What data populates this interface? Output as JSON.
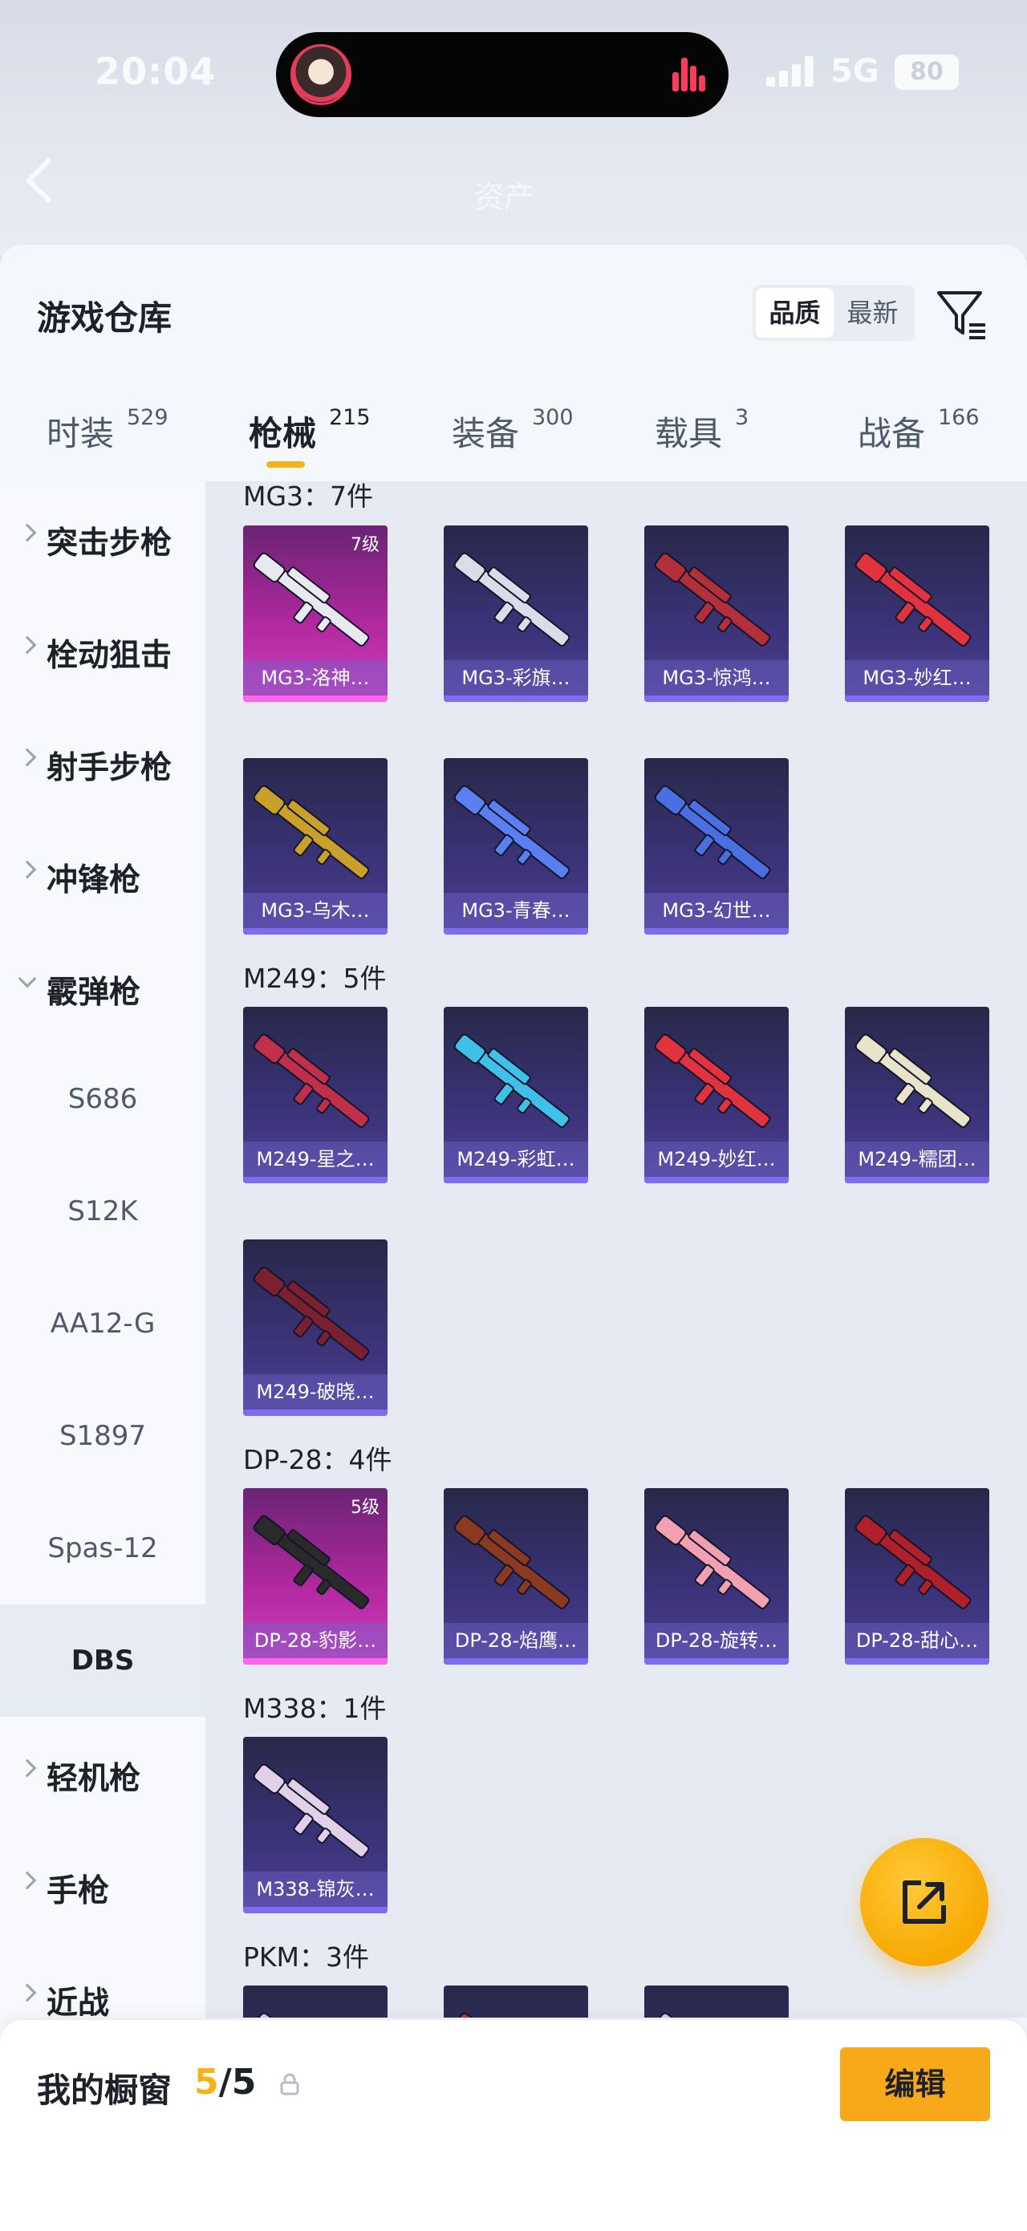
{
  "status_bar": {
    "time": "20:04",
    "network": "5G",
    "battery": "80"
  },
  "background_tabs": [
    "",
    "资产",
    ""
  ],
  "header": {
    "title": "游戏仓库",
    "sort_options": [
      "品质",
      "最新"
    ],
    "sort_selected": "品质"
  },
  "category_tabs": [
    {
      "label": "时装",
      "count": "529",
      "active": false
    },
    {
      "label": "枪械",
      "count": "215",
      "active": true
    },
    {
      "label": "装备",
      "count": "300",
      "active": false
    },
    {
      "label": "载具",
      "count": "3",
      "active": false
    },
    {
      "label": "战备",
      "count": "166",
      "active": false
    }
  ],
  "sidebar": {
    "items": [
      {
        "label": "突击步枪",
        "expanded": false
      },
      {
        "label": "栓动狙击",
        "expanded": false
      },
      {
        "label": "射手步枪",
        "expanded": false
      },
      {
        "label": "冲锋枪",
        "expanded": false
      },
      {
        "label": "霰弹枪",
        "expanded": true
      }
    ],
    "sub_items": [
      "S686",
      "S12K",
      "AA12-G",
      "S1897",
      "Spas-12",
      "DBS"
    ],
    "sub_selected": "DBS",
    "items_after": [
      {
        "label": "轻机枪",
        "expanded": false
      },
      {
        "label": "手枪",
        "expanded": false
      },
      {
        "label": "近战",
        "expanded": false
      }
    ]
  },
  "groups": [
    {
      "title": "MG3：7件",
      "cards": [
        {
          "name": "MG3-洛神…",
          "level": "7级",
          "rarity": "legendary",
          "accent": "#e8e8f0"
        },
        {
          "name": "MG3-彩旗…",
          "level": "",
          "rarity": "epic",
          "accent": "#d9dde8"
        },
        {
          "name": "MG3-惊鸿…",
          "level": "",
          "rarity": "epic",
          "accent": "#b3303a"
        },
        {
          "name": "MG3-妙红…",
          "level": "",
          "rarity": "epic",
          "accent": "#e0333e"
        },
        {
          "name": "MG3-乌木…",
          "level": "",
          "rarity": "epic",
          "accent": "#c9a12a"
        },
        {
          "name": "MG3-青春…",
          "level": "",
          "rarity": "epic",
          "accent": "#5a7ff0"
        },
        {
          "name": "MG3-幻世…",
          "level": "",
          "rarity": "epic",
          "accent": "#4a6fe0"
        }
      ]
    },
    {
      "title": "M249：5件",
      "cards": [
        {
          "name": "M249-星之…",
          "level": "",
          "rarity": "epic",
          "accent": "#c0304a"
        },
        {
          "name": "M249-彩虹…",
          "level": "",
          "rarity": "epic",
          "accent": "#3fc0e8"
        },
        {
          "name": "M249-妙红…",
          "level": "",
          "rarity": "epic",
          "accent": "#e0333e"
        },
        {
          "name": "M249-糯团…",
          "level": "",
          "rarity": "epic",
          "accent": "#e8e4cc"
        },
        {
          "name": "M249-破晓…",
          "level": "",
          "rarity": "epic",
          "accent": "#7a2030"
        }
      ]
    },
    {
      "title": "DP-28：4件",
      "cards": [
        {
          "name": "DP-28-豹影…",
          "level": "5级",
          "rarity": "legendary",
          "accent": "#2a2a2a"
        },
        {
          "name": "DP-28-焰鹰…",
          "level": "",
          "rarity": "epic",
          "accent": "#8a3a20"
        },
        {
          "name": "DP-28-旋转…",
          "level": "",
          "rarity": "epic",
          "accent": "#f0a0b0"
        },
        {
          "name": "DP-28-甜心…",
          "level": "",
          "rarity": "epic",
          "accent": "#b0202a"
        }
      ]
    },
    {
      "title": "M338：1件",
      "cards": [
        {
          "name": "M338-锦灰…",
          "level": "",
          "rarity": "epic",
          "accent": "#e0d0e8"
        }
      ]
    },
    {
      "title": "PKM：3件",
      "cards": [
        {
          "name": "",
          "level": "",
          "rarity": "epic",
          "accent": "#d0d0e0"
        },
        {
          "name": "",
          "level": "",
          "rarity": "epic",
          "accent": "#c03030"
        },
        {
          "name": "",
          "level": "",
          "rarity": "epic",
          "accent": "#d0d0e0"
        }
      ]
    }
  ],
  "bottom_bar": {
    "title": "我的橱窗",
    "count_current": "5",
    "count_sep_total": "/5",
    "edit_label": "编辑"
  },
  "colors": {
    "accent": "#f7b21a",
    "epic_card": "#3a3276",
    "legendary_card": "#b0289e"
  }
}
